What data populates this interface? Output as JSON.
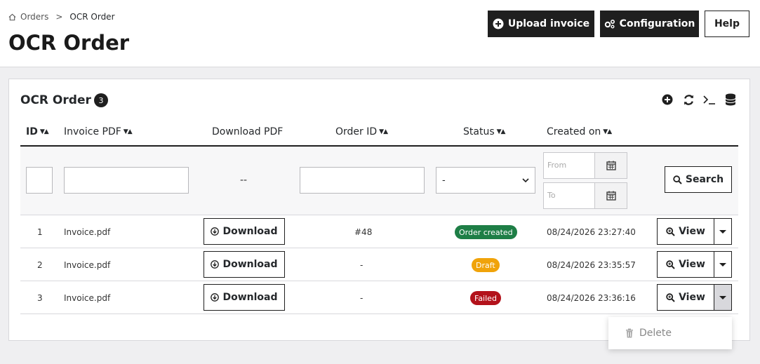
{
  "breadcrumb": {
    "parent": "Orders",
    "separator": ">",
    "current": "OCR Order"
  },
  "page": {
    "title": "OCR Order"
  },
  "toolbar": {
    "upload_label": "Upload invoice",
    "config_label": "Configuration",
    "help_label": "Help"
  },
  "panel": {
    "title": "OCR Order",
    "count": "3",
    "icons": [
      "plus-circle-icon",
      "refresh-icon",
      "terminal-icon",
      "database-icon"
    ]
  },
  "columns": {
    "id": "ID",
    "invoice_pdf": "Invoice PDF",
    "download_pdf": "Download PDF",
    "order_id": "Order ID",
    "status": "Status",
    "created_on": "Created on"
  },
  "filters": {
    "download_placeholder": "--",
    "status_selected": "-",
    "date_from_placeholder": "From",
    "date_to_placeholder": "To",
    "search_label": "Search"
  },
  "rows": [
    {
      "id": "1",
      "invoice": "Invoice.pdf",
      "download_label": "Download",
      "order_id": "#48",
      "status": "Order created",
      "status_color": "#1e7e46",
      "created": "08/24/2026 23:27:40",
      "view_label": "View"
    },
    {
      "id": "2",
      "invoice": "Invoice.pdf",
      "download_label": "Download",
      "order_id": "-",
      "status": "Draft",
      "status_color": "#f0a30a",
      "created": "08/24/2026 23:35:57",
      "view_label": "View"
    },
    {
      "id": "3",
      "invoice": "Invoice.pdf",
      "download_label": "Download",
      "order_id": "-",
      "status": "Failed",
      "status_color": "#b3121b",
      "created": "08/24/2026 23:36:16",
      "view_label": "View"
    }
  ],
  "dropdown": {
    "delete_label": "Delete"
  }
}
